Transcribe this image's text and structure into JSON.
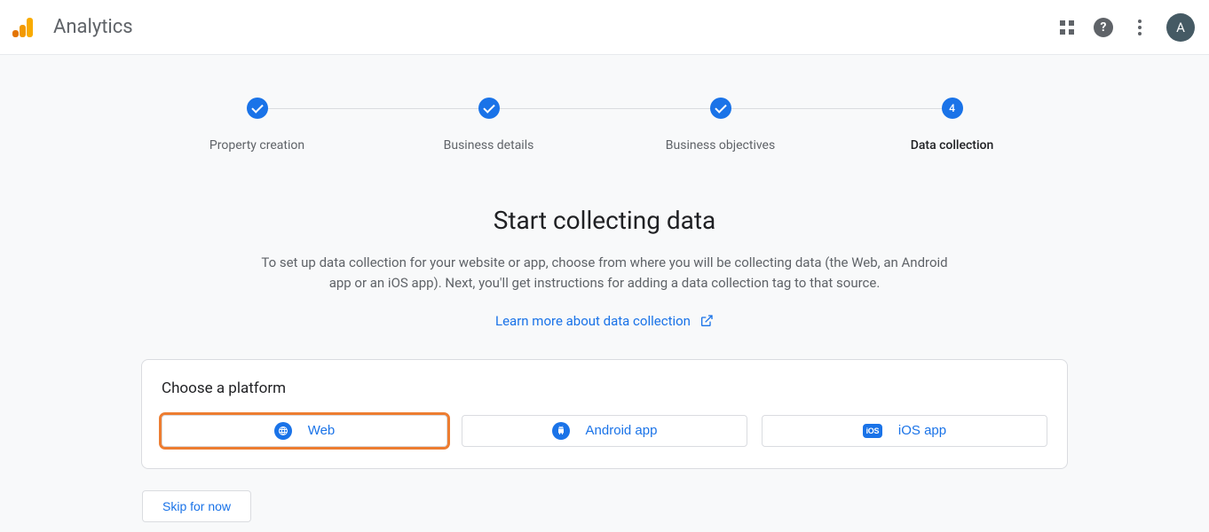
{
  "header": {
    "app_title": "Analytics",
    "avatar_letter": "A"
  },
  "stepper": {
    "steps": [
      {
        "label": "Property creation",
        "state": "done"
      },
      {
        "label": "Business details",
        "state": "done"
      },
      {
        "label": "Business objectives",
        "state": "done"
      },
      {
        "label": "Data collection",
        "state": "active",
        "number": "4"
      }
    ]
  },
  "main": {
    "title": "Start collecting data",
    "description": "To set up data collection for your website or app, choose from where you will be collecting data (the Web, an Android app or an iOS app). Next, you'll get instructions for adding a data collection tag to that source.",
    "learn_more": "Learn more about data collection"
  },
  "card": {
    "title": "Choose a platform",
    "platforms": {
      "web": "Web",
      "android": "Android app",
      "ios": "iOS app",
      "ios_badge": "iOS"
    }
  },
  "footer": {
    "skip": "Skip for now"
  }
}
